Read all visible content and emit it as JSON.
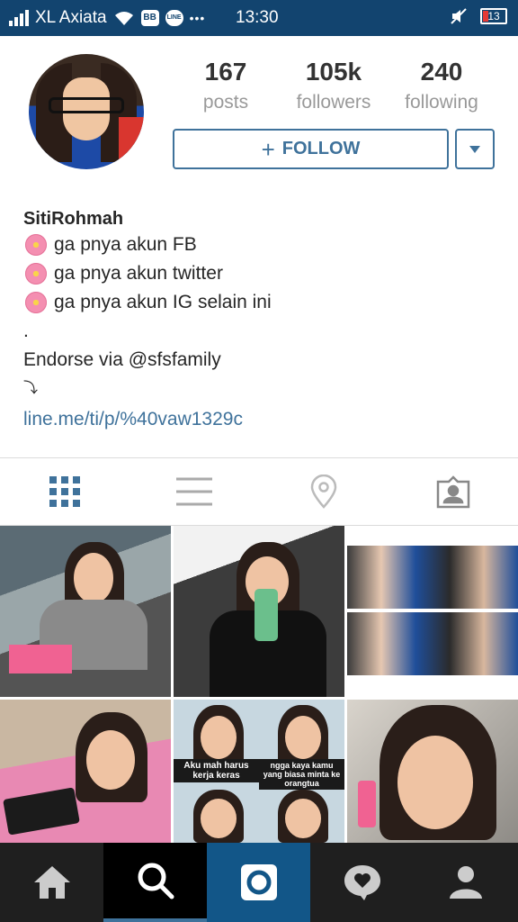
{
  "status_bar": {
    "carrier": "XL Axiata",
    "time": "13:30",
    "battery": "13",
    "icons": [
      "signal-icon",
      "wifi-icon",
      "bbm-icon",
      "line-icon",
      "more-icon",
      "mute-icon",
      "battery-icon"
    ],
    "bbm_glyph": "BB",
    "line_glyph": "LINE",
    "more_glyph": "•••",
    "background": "#12446f"
  },
  "profile": {
    "stats": [
      {
        "value": "167",
        "label": "posts"
      },
      {
        "value": "105k",
        "label": "followers"
      },
      {
        "value": "240",
        "label": "following"
      }
    ],
    "follow_plus": "+",
    "follow_label": "FOLLOW",
    "accent": "#3f729b"
  },
  "bio": {
    "username": "SitiRohmah",
    "lines": [
      "ga pnya akun FB",
      "ga pnya akun twitter",
      "ga pnya akun IG selain ini"
    ],
    "dot": ".",
    "endorse": "Endorse via @sfsfamily",
    "arrow": "⤵",
    "link": "line.me/ti/p/%40vaw1329c"
  },
  "view_tabs": [
    "grid-view",
    "list-view",
    "location-view",
    "tagged-view"
  ],
  "grid": {
    "meme_top_left": "Aku mah harus kerja keras",
    "meme_top_right": "ngga kaya kamu yang biasa minta ke orangtua"
  },
  "bottom_nav": [
    "home",
    "search",
    "camera",
    "activity",
    "profile"
  ]
}
